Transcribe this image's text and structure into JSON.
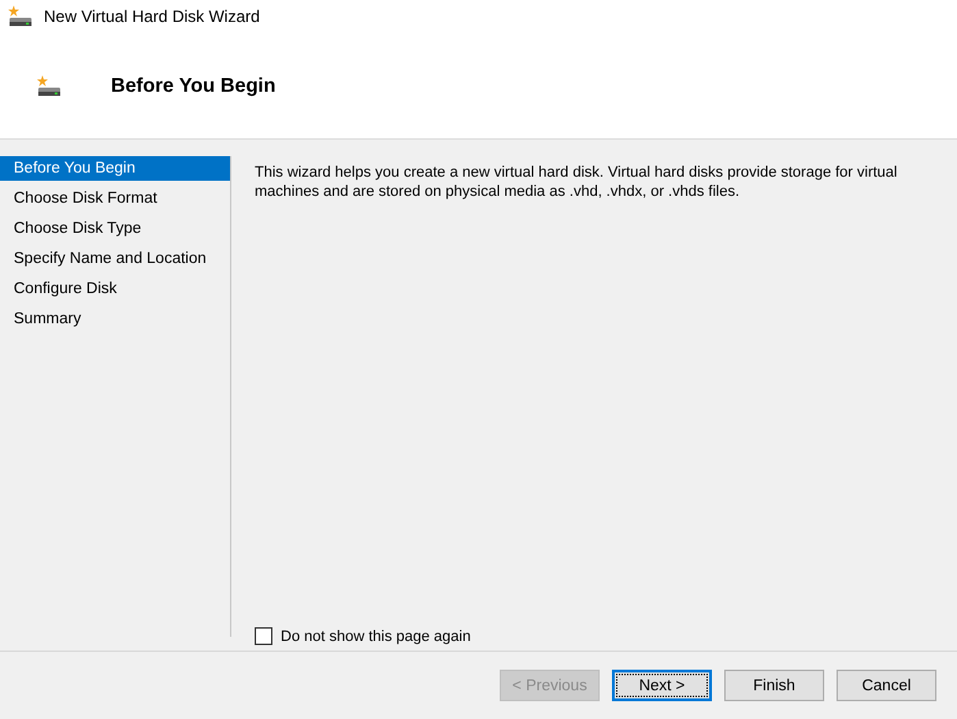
{
  "window": {
    "title": "New Virtual Hard Disk Wizard"
  },
  "header": {
    "title": "Before You Begin"
  },
  "steps": [
    {
      "label": "Before You Begin",
      "selected": true
    },
    {
      "label": "Choose Disk Format",
      "selected": false
    },
    {
      "label": "Choose Disk Type",
      "selected": false
    },
    {
      "label": "Specify Name and Location",
      "selected": false
    },
    {
      "label": "Configure Disk",
      "selected": false
    },
    {
      "label": "Summary",
      "selected": false
    }
  ],
  "description": "This wizard helps you create a new virtual hard disk. Virtual hard disks provide storage for virtual machines and are stored on physical media as .vhd, .vhdx, or .vhds files.",
  "dont_show_again": {
    "label": "Do not show this page again",
    "checked": false
  },
  "buttons": [
    {
      "label": "< Previous",
      "disabled": true,
      "default": false
    },
    {
      "label": "Next >",
      "disabled": false,
      "default": true
    },
    {
      "label": "Finish",
      "disabled": false,
      "default": false
    },
    {
      "label": "Cancel",
      "disabled": false,
      "default": false
    }
  ]
}
